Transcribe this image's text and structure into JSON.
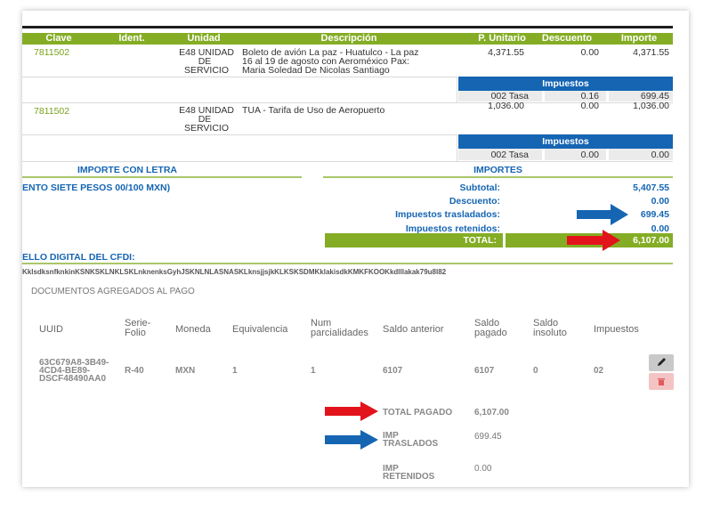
{
  "headers": {
    "clave": "Clave",
    "ident": "Ident.",
    "unidad": "Unidad",
    "descripcion": "Descripción",
    "p_unitario": "P. Unitario",
    "descuento": "Descuento",
    "importe": "Importe"
  },
  "items": [
    {
      "clave": "7811502",
      "unidad": [
        "E48 UNIDAD",
        "DE",
        "SERVICIO"
      ],
      "descripcion": [
        "Boleto de avión La paz - Huatulco - La paz",
        "16 al 19 de agosto con Aeroméxico Pax:",
        "Maria Soledad De Nicolas Santiago"
      ],
      "p_unitario": "4,371.55",
      "descuento": "0.00",
      "importe": "4,371.55",
      "impuestos_label": "Impuestos",
      "impuestos": {
        "tipo": "002 Tasa",
        "tasa": "0.16",
        "importe": "699.45"
      }
    },
    {
      "clave": "7811502",
      "unidad": [
        "E48 UNIDAD",
        "DE",
        "SERVICIO"
      ],
      "descripcion": [
        "TUA - Tarifa de Uso de Aeropuerto"
      ],
      "p_unitario": "1,036.00",
      "descuento": "0.00",
      "importe": "1,036.00",
      "impuestos_label": "Impuestos",
      "impuestos": {
        "tipo": "002 Tasa",
        "tasa": "0.00",
        "importe": "0.00"
      }
    }
  ],
  "importe_letra": {
    "title": "IMPORTE CON LETRA",
    "text": "ENTO SIETE PESOS 00/100 MXN)"
  },
  "importes": {
    "title": "IMPORTES",
    "subtotal_label": "Subtotal:",
    "subtotal": "5,407.55",
    "descuento_label": "Descuento:",
    "descuento": "0.00",
    "trasladados_label": "Impuestos trasladados:",
    "trasladados": "699.45",
    "retenidos_label": "Impuestos retenidos:",
    "retenidos": "0.00",
    "total_label": "TOTAL:",
    "total": "6,107.00"
  },
  "sello": {
    "label": "ELLO DIGITAL DEL CFDI:",
    "value": "KklsdksnfknkinKSNKSKLNKLSKLnknenksGyhJSKNLNLASNASKLknsjjsjkKLKSKSDMKklakisdkKMKFKOOKkdlllakak79u8l82"
  },
  "docs": {
    "title": "DOCUMENTOS AGREGADOS AL PAGO",
    "headers": {
      "uuid": "UUID",
      "serie": [
        "Serie-",
        "Folio"
      ],
      "moneda": "Moneda",
      "equivalencia": "Equivalencia",
      "num": [
        "Num",
        "parcialidades"
      ],
      "saldo_anterior": "Saldo anterior",
      "saldo_pagado": [
        "Saldo",
        "pagado"
      ],
      "saldo_insoluto": [
        "Saldo",
        "insoluto"
      ],
      "impuestos": "Impuestos"
    },
    "row": {
      "uuid": [
        "63C679A8-3B49-",
        "4CD4-BE89-",
        "DSCF48490AA0"
      ],
      "serie": "R-40",
      "moneda": "MXN",
      "equivalencia": "1",
      "num": "1",
      "saldo_anterior": "6107",
      "saldo_pagado": "6107",
      "saldo_insoluto": "0",
      "impuestos": "02"
    },
    "totals": {
      "pagado_label": "TOTAL PAGADO",
      "pagado": "6,107.00",
      "trasladados_label": [
        "IMP",
        "TRASLADOS"
      ],
      "trasladados": "699.45",
      "retenidos_label": [
        "IMP",
        "RETENIDOS"
      ],
      "retenidos": "0.00"
    }
  },
  "icons": {
    "edit": "pencil-icon",
    "delete": "trash-icon"
  },
  "colors": {
    "green": "#84ad25",
    "blue": "#1565b3",
    "red_arrow": "#e3131b",
    "blue_arrow": "#1565b3"
  }
}
